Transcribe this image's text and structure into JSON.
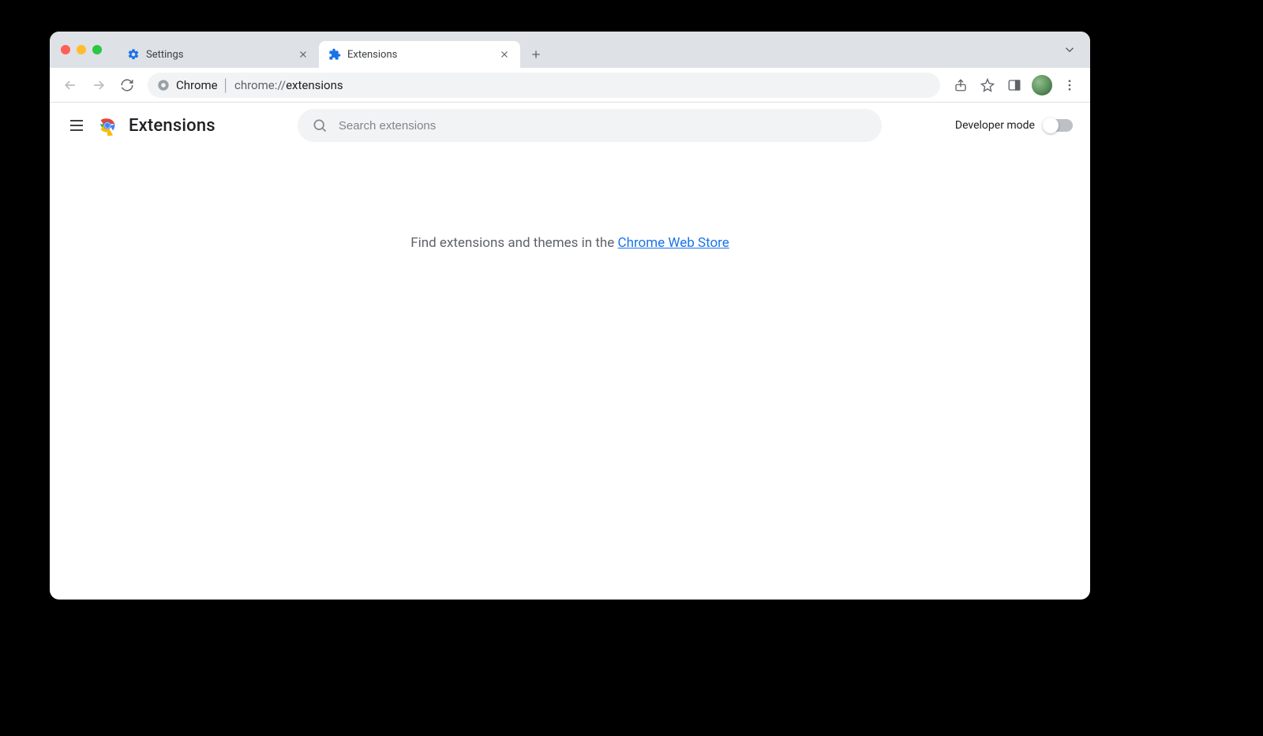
{
  "tabs": [
    {
      "label": "Settings",
      "active": false
    },
    {
      "label": "Extensions",
      "active": true
    }
  ],
  "omnibox": {
    "origin_label": "Chrome",
    "url_proto": "chrome://",
    "url_path": "extensions"
  },
  "page": {
    "title": "Extensions",
    "search_placeholder": "Search extensions",
    "dev_mode_label": "Developer mode",
    "empty_prefix": "Find extensions and themes in the ",
    "empty_link": "Chrome Web Store"
  }
}
